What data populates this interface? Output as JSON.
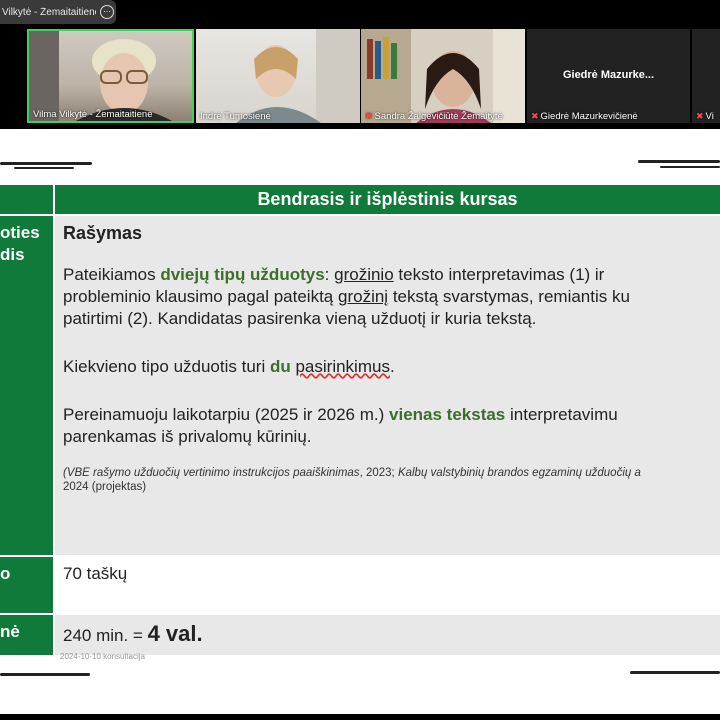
{
  "window": {
    "title": "Vilkytė - Žemaitaitienė's sc",
    "menu_icon": "more-icon"
  },
  "participants": [
    {
      "name": "Vilma Vilkytė - Žemaitaitienė",
      "muted": false,
      "active": true
    },
    {
      "name": "Indrė Tumosienė",
      "muted": false,
      "active": false
    },
    {
      "name": "Sandra Žalgevičiūtė Žemaitytė",
      "muted": true,
      "active": false
    },
    {
      "name": "Giedrė Mazurkevičienė",
      "muted": true,
      "active": false,
      "display_name": "Giedrė  Mazurke..."
    },
    {
      "name": "Vi",
      "muted": true,
      "active": false
    }
  ],
  "slide": {
    "header": "Bendrasis ir išplėstinis kursas",
    "rows": [
      {
        "left_lines": [
          "oties",
          "dis"
        ],
        "heading": "Rašymas",
        "p1": {
          "a": "Pateikiamos ",
          "b": "dviejų tipų užduotys",
          "c": ": ",
          "d": "grožinio",
          "e": " teksto interpretavimas (1) ir",
          "line2a": "probleminio klausimo pagal pateiktą ",
          "line2b": "grožinį",
          "line2c": " tekstą svarstymas, remiantis ku",
          "line3": "patirtimi (2). Kandidatas pasirenka vieną užduotį ir kuria tekstą."
        },
        "p2": {
          "a": "Kiekvieno tipo užduotis turi ",
          "b": "du",
          "c": " ",
          "d": "pasirinkimus",
          "e": "."
        },
        "p3": {
          "a": "Pereinamuoju laikotarpiu (2025 ir 2026 m.) ",
          "b": "vienas tekstas",
          "c": " interpretavimu",
          "line2": "parenkamas iš privalomų kūrinių."
        },
        "cite": {
          "a": "(VBE rašymo užduočių vertinimo instrukcijos paaiškinimas",
          "b": ", 2023; ",
          "c": "Kalbų valstybinių brandos egzaminų užduočių a",
          "line2": "2024 (projektas)"
        }
      },
      {
        "left": "o",
        "text": "70 taškų"
      },
      {
        "left": "nė",
        "text_a": "240 min. = ",
        "text_b": "4 val."
      }
    ],
    "footer": "2024-10-10 konsultacija"
  }
}
